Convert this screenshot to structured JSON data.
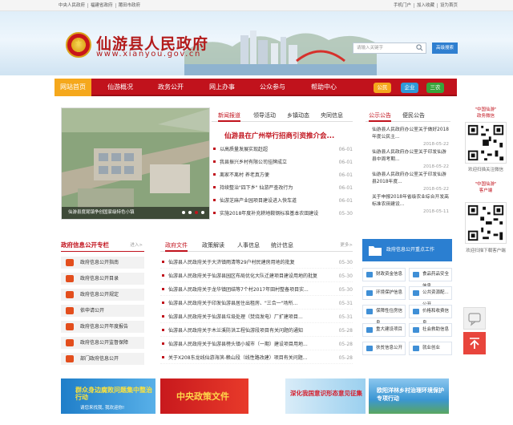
{
  "topbar": {
    "left_links": [
      "中央人民政府",
      "福建省政府",
      "莆田市政府"
    ],
    "right_links": [
      "手机门户",
      "加入收藏",
      "设为首页"
    ]
  },
  "site": {
    "title": "仙游县人民政府",
    "url": "www.xianyou.gov.cn"
  },
  "search": {
    "placeholder": "请输入关键字",
    "advanced_label": "高级搜索"
  },
  "nav": {
    "items": [
      "网站首页",
      "仙游概况",
      "政务公开",
      "网上办事",
      "公众参与",
      "帮助中心"
    ],
    "active": "网站首页",
    "pills": [
      {
        "label": "公民",
        "color": "#f5a81c"
      },
      {
        "label": "企业",
        "color": "#2f9ad8"
      },
      {
        "label": "三农",
        "color": "#37a43b"
      }
    ]
  },
  "hero": {
    "caption": "仙游县度尾镇争创国家级特色小镇"
  },
  "news": {
    "tabs": [
      "新闻报道",
      "领导活动",
      "乡镇动态",
      "央同信息"
    ],
    "headline": "仙游县在广州举行招商引资推介会...",
    "items": [
      {
        "title": "以高质量发展实现赶超",
        "date": "06-01"
      },
      {
        "title": "我县振兴乡村有限公司挂牌成立",
        "date": "06-01"
      },
      {
        "title": "离家不离村  养老真方便",
        "date": "06-01"
      },
      {
        "title": "持续整治\"四下乡\" 仙游严查改行为",
        "date": "06-01"
      },
      {
        "title": "仙游芝麻产业园项目建设进入快车道",
        "date": "06-01"
      },
      {
        "title": "实施2018年度补充耕地鞍钢标准基本农田建设",
        "date": "05-30"
      }
    ]
  },
  "notices": {
    "tabs": [
      "公示公告",
      "便民公告"
    ],
    "items": [
      {
        "title": "仙游县人民政府办公室关于做好2018年度公民主...",
        "date": "2018-05-22"
      },
      {
        "title": "仙游县人民政府办公室关于印发仙游县中周考期...",
        "date": "2018-05-22"
      },
      {
        "title": "仙游县人民政府办公室关于印发仙游县2018年度...",
        "date": "2018-05-22"
      },
      {
        "title": "关于申报2018年省级农业综合开发高标准农田建设...",
        "date": "2018-05-11"
      }
    ]
  },
  "qr": {
    "wechat_title": "\"中国仙游\"\n政务微信",
    "wechat_caption": "欢迎扫描关注微信",
    "app_title": "\"中国仙游\"\n客户端",
    "app_caption": "欢迎扫描下载客户端"
  },
  "disclosure": {
    "title": "政府信息公开专栏",
    "more": "进入>",
    "items": [
      "政府信息公开指南",
      "政府信息公开目录",
      "政府信息公开规定",
      "依申请公开",
      "政府信息公开年度报告",
      "政府信息公开监督保障",
      "部门政府信息公开"
    ]
  },
  "docs": {
    "tabs": [
      "政府文件",
      "政策解读",
      "人事信息",
      "统计信息"
    ],
    "more": "更多>",
    "items": [
      {
        "title": "仙游县人民政府关于大济镇雨清等29户村民建房用地的批复",
        "date": "05-30"
      },
      {
        "title": "仙游县人民政府关于仙游县园区布局优化大队迁建项目建设用地的批复",
        "date": "05-30"
      },
      {
        "title": "仙游县人民政府关于龙华镇团结等7个村2017年田村整备项目实...",
        "date": "05-30"
      },
      {
        "title": "仙游县人民政府关于印发仙游县居住出租房、\"三合一\"场所...",
        "date": "05-31"
      },
      {
        "title": "仙游县人民政府关于仙游县垃圾处理（焚烧发电）厂扩建项目...",
        "date": "05-31"
      },
      {
        "title": "仙游县人民政府关于木兰溪防洪工程仙游段项目有关问题的通知",
        "date": "05-28"
      },
      {
        "title": "仙游县人民政府关于仙游县榜头镇小城市（一期）建设项目用地...",
        "date": "05-28"
      },
      {
        "title": "关于X208东龙线仙游海滨-赖山段（线性路改建）项目有关问题...",
        "date": "05-28"
      }
    ]
  },
  "key_work": {
    "label": "政府信息公开重点工作",
    "items": [
      "财政资金信息",
      "食品药品安全信息",
      "环境保护信息",
      "公共资源配...公开",
      "保障性住房信息",
      "价格和收费信息",
      "重大建设项目",
      "社会救助信息",
      "扶贫信息公开",
      "就业创业"
    ]
  },
  "bottom_banners": [
    {
      "label": "群众身边腐败问题集中整治行动",
      "sub": "请您来找我, 我欢迎你!"
    },
    {
      "label": "中央政策文件",
      "sub": ""
    },
    {
      "label": "深化我国意识形态意见征集",
      "sub": ""
    },
    {
      "label": "欧阳洋林乡村治理环境保护专项行动",
      "sub": ""
    }
  ]
}
